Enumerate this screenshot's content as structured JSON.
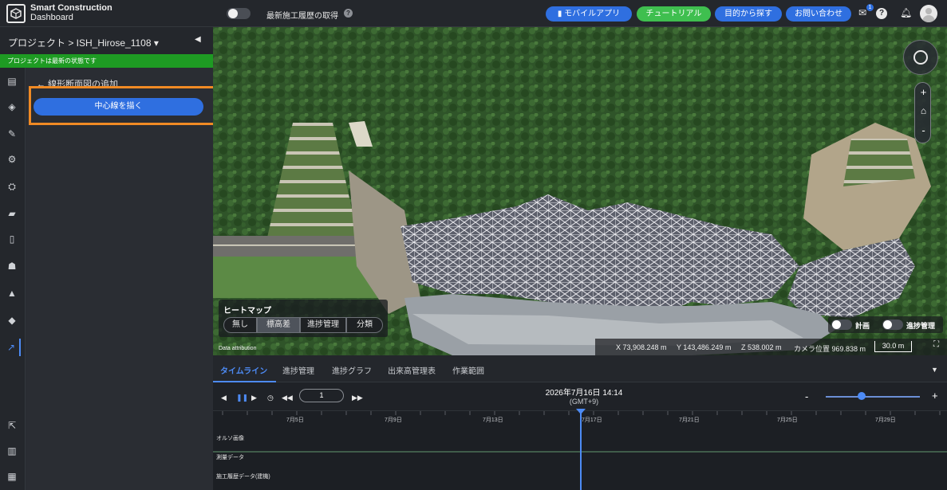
{
  "header": {
    "brand_line1": "Smart Construction",
    "brand_line2": "Dashboard",
    "history_toggle_label": "最新施工履歴の取得",
    "help_symbol": "?",
    "buttons": {
      "mobile_app": "モバイルアプリ",
      "tutorial": "チュートリアル",
      "find_by_purpose": "目的から探す",
      "contact": "お問い合わせ"
    },
    "notification_count": "1"
  },
  "project": {
    "breadcrumb": "プロジェクト > ISH_Hirose_1108 ▾",
    "collapse_symbol": "◀",
    "status": "プロジェクトは最新の状態です"
  },
  "panel": {
    "back_title": "←  線形断面図の追加",
    "draw_button": "中心線を描く"
  },
  "heatmap": {
    "title": "ヒートマップ",
    "options": [
      "無し",
      "標高差",
      "進捗管理",
      "分類"
    ],
    "selected": "標高差"
  },
  "map_toggles": {
    "plan": "計画",
    "progress": "進捗管理"
  },
  "map_footer": {
    "attribution": "Data attribution",
    "x": "X 73,908.248 m",
    "y": "Y 143,486.249 m",
    "z": "Z 538.002 m",
    "camera": "カメラ位置 969.838 m",
    "scale": "30.0 m"
  },
  "zoom": {
    "plus": "+",
    "minus": "-"
  },
  "timeline": {
    "tabs": [
      "タイムライン",
      "進捗管理",
      "進捗グラフ",
      "出来高管理表",
      "作業範囲"
    ],
    "active_tab": "タイムライン",
    "speed_value": "1",
    "datetime": "2026年7月16日 14:14",
    "timezone": "(GMT+9)",
    "ticks": [
      "7月5日",
      "7月9日",
      "7月13日",
      "7月17日",
      "7月21日",
      "7月25日",
      "7月29日"
    ],
    "rows": [
      "オルソ画像",
      "測量データ",
      "施工履歴データ(建機)"
    ]
  },
  "colors": {
    "accent_blue": "#2f6fe0",
    "accent_green": "#3fbf4f",
    "status_green": "#1e9b23",
    "highlight_orange": "#f08a24"
  }
}
